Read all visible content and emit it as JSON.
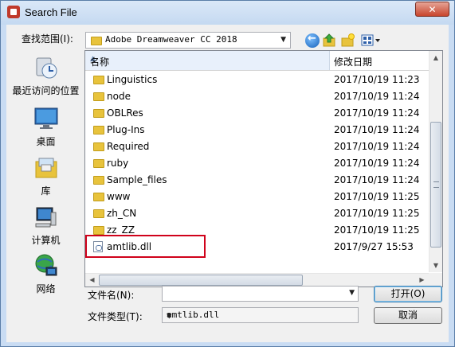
{
  "window": {
    "title": "Search File",
    "close_label": "✕"
  },
  "lookin": {
    "label": "查找范围(I):",
    "value": "Adobe Dreamweaver CC 2018"
  },
  "toolbar": {
    "back_icon": "back-arrow-icon",
    "up_icon": "folder-up-icon",
    "newfolder_icon": "new-folder-icon",
    "views_icon": "view-menu-icon"
  },
  "places": [
    {
      "label": "最近访问的位置",
      "icon": "recent-places-icon"
    },
    {
      "label": "桌面",
      "icon": "desktop-icon"
    },
    {
      "label": "库",
      "icon": "libraries-icon"
    },
    {
      "label": "计算机",
      "icon": "computer-icon"
    },
    {
      "label": "网络",
      "icon": "network-icon"
    }
  ],
  "columns": {
    "name": "名称",
    "date": "修改日期"
  },
  "files": [
    {
      "name": "Linguistics",
      "date": "2017/10/19 11:23",
      "type": "folder"
    },
    {
      "name": "node",
      "date": "2017/10/19 11:24",
      "type": "folder"
    },
    {
      "name": "OBLRes",
      "date": "2017/10/19 11:24",
      "type": "folder"
    },
    {
      "name": "Plug-Ins",
      "date": "2017/10/19 11:24",
      "type": "folder"
    },
    {
      "name": "Required",
      "date": "2017/10/19 11:24",
      "type": "folder"
    },
    {
      "name": "ruby",
      "date": "2017/10/19 11:24",
      "type": "folder"
    },
    {
      "name": "Sample_files",
      "date": "2017/10/19 11:24",
      "type": "folder"
    },
    {
      "name": "www",
      "date": "2017/10/19 11:25",
      "type": "folder"
    },
    {
      "name": "zh_CN",
      "date": "2017/10/19 11:25",
      "type": "folder"
    },
    {
      "name": "zz_ZZ",
      "date": "2017/10/19 11:25",
      "type": "folder"
    },
    {
      "name": "amtlib.dll",
      "date": "2017/9/27 15:53",
      "type": "file"
    }
  ],
  "filename": {
    "label": "文件名(N):",
    "value": ""
  },
  "filetype": {
    "label": "文件类型(T):",
    "value": "amtlib.dll"
  },
  "buttons": {
    "open": "打开(O)",
    "cancel": "取消"
  },
  "colors": {
    "highlight": "#d0021b",
    "folder": "#e8c33c",
    "title_bg": "#c9dcf3"
  }
}
